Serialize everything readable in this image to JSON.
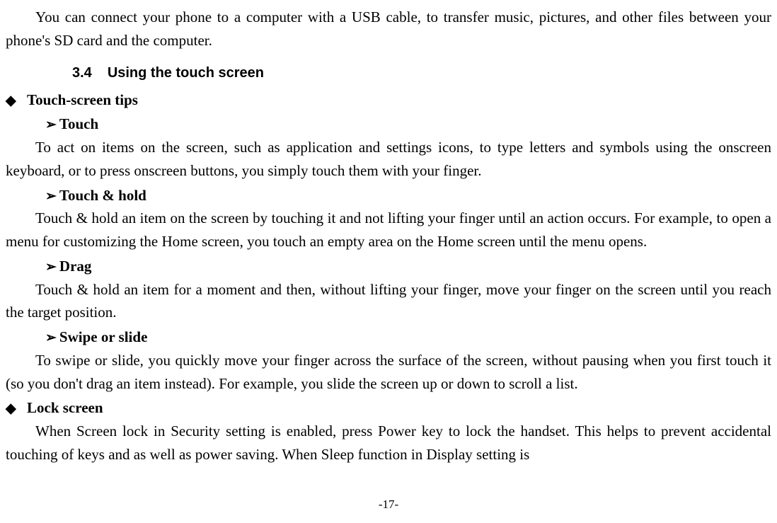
{
  "intro": "You can connect your phone to a computer with a USB cable, to transfer music, pictures, and other files between your phone's SD card and the computer.",
  "section": {
    "number": "3.4",
    "title": "Using the touch screen"
  },
  "tips_heading": "Touch-screen tips",
  "touch": {
    "heading": "Touch",
    "body": "To act on items on the screen, such as application and settings icons, to type letters and symbols using the onscreen keyboard, or to press onscreen buttons, you simply touch them with your finger."
  },
  "touch_hold": {
    "heading": "Touch & hold",
    "body": "Touch & hold an item on the screen by touching it and not lifting your finger until an action occurs. For example, to open a menu for customizing the Home screen, you touch an empty area on the Home screen until the menu opens."
  },
  "drag": {
    "heading": "Drag",
    "body": "Touch & hold an item for a moment and then, without lifting your finger, move your finger on the screen until you reach the target position."
  },
  "swipe": {
    "heading": "Swipe or slide",
    "body": "To swipe or slide, you quickly move your finger across the surface of the screen, without pausing when you first touch it (so you don't drag an item instead). For example, you slide the screen up or down to scroll a list."
  },
  "lock": {
    "heading": "Lock screen",
    "body": "When Screen lock in Security setting is enabled, press Power key to lock the handset. This helps to prevent accidental touching of keys and as well as power saving. When Sleep function in Display setting is"
  },
  "page_number": "-17-"
}
